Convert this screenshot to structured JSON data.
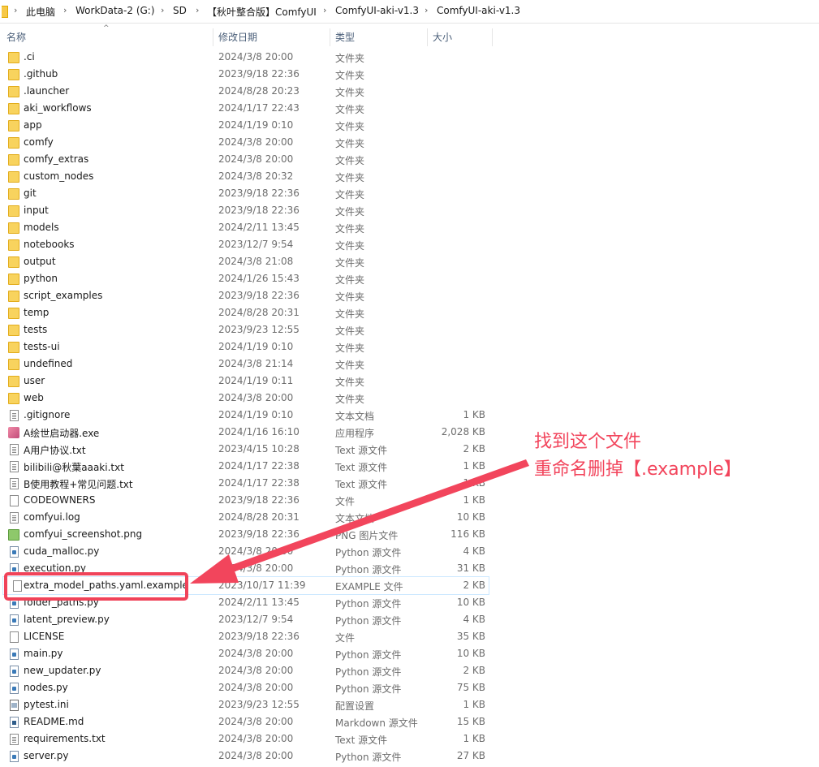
{
  "address_bar": {
    "crumbs": [
      "此电脑",
      "WorkData-2 (G:)",
      "SD",
      "【秋叶整合版】ComfyUI",
      "ComfyUI-aki-v1.3",
      "ComfyUI-aki-v1.3"
    ],
    "separator": "›"
  },
  "columns": {
    "name": "名称",
    "date": "修改日期",
    "type": "类型",
    "size": "大小",
    "sort_indicator": "^"
  },
  "files": [
    {
      "name": ".ci",
      "date": "2024/3/8 20:00",
      "type": "文件夹",
      "size": "",
      "icon": "folder"
    },
    {
      "name": ".github",
      "date": "2023/9/18 22:36",
      "type": "文件夹",
      "size": "",
      "icon": "folder"
    },
    {
      "name": ".launcher",
      "date": "2024/8/28 20:23",
      "type": "文件夹",
      "size": "",
      "icon": "folder"
    },
    {
      "name": "aki_workflows",
      "date": "2024/1/17 22:43",
      "type": "文件夹",
      "size": "",
      "icon": "folder"
    },
    {
      "name": "app",
      "date": "2024/1/19 0:10",
      "type": "文件夹",
      "size": "",
      "icon": "folder"
    },
    {
      "name": "comfy",
      "date": "2024/3/8 20:00",
      "type": "文件夹",
      "size": "",
      "icon": "folder"
    },
    {
      "name": "comfy_extras",
      "date": "2024/3/8 20:00",
      "type": "文件夹",
      "size": "",
      "icon": "folder"
    },
    {
      "name": "custom_nodes",
      "date": "2024/3/8 20:32",
      "type": "文件夹",
      "size": "",
      "icon": "folder"
    },
    {
      "name": "git",
      "date": "2023/9/18 22:36",
      "type": "文件夹",
      "size": "",
      "icon": "folder"
    },
    {
      "name": "input",
      "date": "2023/9/18 22:36",
      "type": "文件夹",
      "size": "",
      "icon": "folder"
    },
    {
      "name": "models",
      "date": "2024/2/11 13:45",
      "type": "文件夹",
      "size": "",
      "icon": "folder"
    },
    {
      "name": "notebooks",
      "date": "2023/12/7 9:54",
      "type": "文件夹",
      "size": "",
      "icon": "folder"
    },
    {
      "name": "output",
      "date": "2024/3/8 21:08",
      "type": "文件夹",
      "size": "",
      "icon": "folder"
    },
    {
      "name": "python",
      "date": "2024/1/26 15:43",
      "type": "文件夹",
      "size": "",
      "icon": "folder"
    },
    {
      "name": "script_examples",
      "date": "2023/9/18 22:36",
      "type": "文件夹",
      "size": "",
      "icon": "folder"
    },
    {
      "name": "temp",
      "date": "2024/8/28 20:31",
      "type": "文件夹",
      "size": "",
      "icon": "folder"
    },
    {
      "name": "tests",
      "date": "2023/9/23 12:55",
      "type": "文件夹",
      "size": "",
      "icon": "folder"
    },
    {
      "name": "tests-ui",
      "date": "2024/1/19 0:10",
      "type": "文件夹",
      "size": "",
      "icon": "folder"
    },
    {
      "name": "undefined",
      "date": "2024/3/8 21:14",
      "type": "文件夹",
      "size": "",
      "icon": "folder"
    },
    {
      "name": "user",
      "date": "2024/1/19 0:11",
      "type": "文件夹",
      "size": "",
      "icon": "folder"
    },
    {
      "name": "web",
      "date": "2024/3/8 20:00",
      "type": "文件夹",
      "size": "",
      "icon": "folder"
    },
    {
      "name": ".gitignore",
      "date": "2024/1/19 0:10",
      "type": "文本文档",
      "size": "1 KB",
      "icon": "txt"
    },
    {
      "name": "A绘世启动器.exe",
      "date": "2024/1/16 16:10",
      "type": "应用程序",
      "size": "2,028 KB",
      "icon": "exe"
    },
    {
      "name": "A用户协议.txt",
      "date": "2023/4/15 10:28",
      "type": "Text 源文件",
      "size": "2 KB",
      "icon": "txt"
    },
    {
      "name": "bilibili@秋葉aaaki.txt",
      "date": "2024/1/17 22:38",
      "type": "Text 源文件",
      "size": "1 KB",
      "icon": "txt"
    },
    {
      "name": "B使用教程+常见问题.txt",
      "date": "2024/1/17 22:38",
      "type": "Text 源文件",
      "size": "1 KB",
      "icon": "txt"
    },
    {
      "name": "CODEOWNERS",
      "date": "2023/9/18 22:36",
      "type": "文件",
      "size": "1 KB",
      "icon": "file"
    },
    {
      "name": "comfyui.log",
      "date": "2024/8/28 20:31",
      "type": "文本文档",
      "size": "10 KB",
      "icon": "txt"
    },
    {
      "name": "comfyui_screenshot.png",
      "date": "2023/9/18 22:36",
      "type": "PNG 图片文件",
      "size": "116 KB",
      "icon": "png"
    },
    {
      "name": "cuda_malloc.py",
      "date": "2024/3/8 20:00",
      "type": "Python 源文件",
      "size": "4 KB",
      "icon": "py"
    },
    {
      "name": "execution.py",
      "date": "2024/3/8 20:00",
      "type": "Python 源文件",
      "size": "31 KB",
      "icon": "py"
    },
    {
      "name": "extra_model_paths.yaml.example",
      "date": "2023/10/17 11:39",
      "type": "EXAMPLE 文件",
      "size": "2 KB",
      "icon": "file",
      "selected": true
    },
    {
      "name": "folder_paths.py",
      "date": "2024/2/11 13:45",
      "type": "Python 源文件",
      "size": "10 KB",
      "icon": "py"
    },
    {
      "name": "latent_preview.py",
      "date": "2023/12/7 9:54",
      "type": "Python 源文件",
      "size": "4 KB",
      "icon": "py"
    },
    {
      "name": "LICENSE",
      "date": "2023/9/18 22:36",
      "type": "文件",
      "size": "35 KB",
      "icon": "file"
    },
    {
      "name": "main.py",
      "date": "2024/3/8 20:00",
      "type": "Python 源文件",
      "size": "10 KB",
      "icon": "py"
    },
    {
      "name": "new_updater.py",
      "date": "2024/3/8 20:00",
      "type": "Python 源文件",
      "size": "2 KB",
      "icon": "py"
    },
    {
      "name": "nodes.py",
      "date": "2024/3/8 20:00",
      "type": "Python 源文件",
      "size": "75 KB",
      "icon": "py"
    },
    {
      "name": "pytest.ini",
      "date": "2023/9/23 12:55",
      "type": "配置设置",
      "size": "1 KB",
      "icon": "ini"
    },
    {
      "name": "README.md",
      "date": "2024/3/8 20:00",
      "type": "Markdown 源文件",
      "size": "15 KB",
      "icon": "md"
    },
    {
      "name": "requirements.txt",
      "date": "2024/3/8 20:00",
      "type": "Text 源文件",
      "size": "1 KB",
      "icon": "txt"
    },
    {
      "name": "server.py",
      "date": "2024/3/8 20:00",
      "type": "Python 源文件",
      "size": "27 KB",
      "icon": "py"
    }
  ],
  "annotation": {
    "line1": "找到这个文件",
    "line2": "重命名删掉【.example】",
    "color": "#f2455c"
  }
}
